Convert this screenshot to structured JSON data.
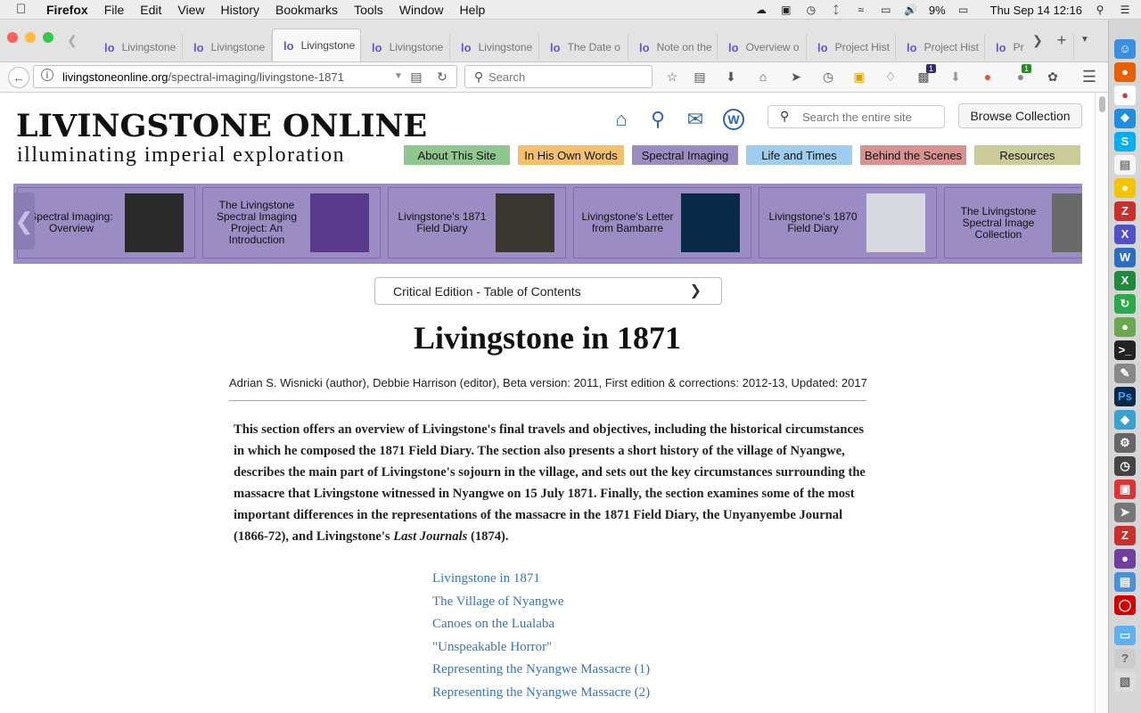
{
  "menubar": {
    "app": "Firefox",
    "items": [
      "File",
      "Edit",
      "View",
      "History",
      "Bookmarks",
      "Tools",
      "Window",
      "Help"
    ],
    "battery": "9%",
    "clock": "Thu Sep 14  12:16"
  },
  "tabs": [
    {
      "label": "Livingstone"
    },
    {
      "label": "Livingstone"
    },
    {
      "label": "Livingstone",
      "active": true
    },
    {
      "label": "Livingstone"
    },
    {
      "label": "Livingstone"
    },
    {
      "label": "The Date o"
    },
    {
      "label": "Note on the"
    },
    {
      "label": "Overview o"
    },
    {
      "label": "Project Hist"
    },
    {
      "label": "Project Hist"
    },
    {
      "label": "Pr"
    }
  ],
  "toolbar": {
    "url_host": "livingstoneonline.org",
    "url_path": "/spectral-imaging/livingstone-1871",
    "search_placeholder": "Search",
    "badge1": "1",
    "badge2": "1"
  },
  "site": {
    "logo_title": "LIVINGSTONE ONLINE",
    "logo_tagline": "illuminating imperial exploration",
    "search_placeholder": "Search the entire site",
    "browse_label": "Browse Collection",
    "nav": [
      {
        "label": "About This Site",
        "color": "#8fc78f"
      },
      {
        "label": "In His Own Words",
        "color": "#f5c06a"
      },
      {
        "label": "Spectral Imaging",
        "color": "#9b8cc4"
      },
      {
        "label": "Life and Times",
        "color": "#9fcdf0"
      },
      {
        "label": "Behind the Scenes",
        "color": "#d9928f"
      },
      {
        "label": "Resources",
        "color": "#cccc99"
      }
    ]
  },
  "carousel": [
    {
      "label": "Spectral Imaging: Overview"
    },
    {
      "label": "The Livingstone Spectral Imaging Project: An Introduction"
    },
    {
      "label": "Livingstone's 1871 Field Diary"
    },
    {
      "label": "Livingstone's Letter from Bambarre"
    },
    {
      "label": "Livingstone's 1870 Field Diary"
    },
    {
      "label": "The Livingstone Spectral Image Collection"
    }
  ],
  "article": {
    "toc_button": "Critical Edition - Table of Contents",
    "title": "Livingstone in 1871",
    "byline": "Adrian S. Wisnicki (author), Debbie Harrison (editor), Beta version: 2011, First edition & corrections: 2012-13, Updated: 2017",
    "abstract_main": "This section offers an overview of Livingstone's final travels and objectives, including the historical circumstances in which he composed the 1871 Field Diary. The section also presents a short history of the village of Nyangwe, describes the main part of Livingstone's sojourn in the village, and sets out the key circumstances surrounding the massacre that Livingstone witnessed in Nyangwe on 15 July 1871. Finally, the section examines some of the most important differences in the representations of the massacre in the 1871 Field Diary, the Unyanyembe Journal (1866-72), and Livingstone's ",
    "abstract_italic": "Last Journals",
    "abstract_end": " (1874).",
    "links": [
      "Livingstone in 1871",
      "The Village of Nyangwe",
      "Canoes on the Lualaba",
      "\"Unspeakable Horror\"",
      "Representing the Nyangwe Massacre (1)",
      "Representing the Nyangwe Massacre (2)"
    ]
  }
}
